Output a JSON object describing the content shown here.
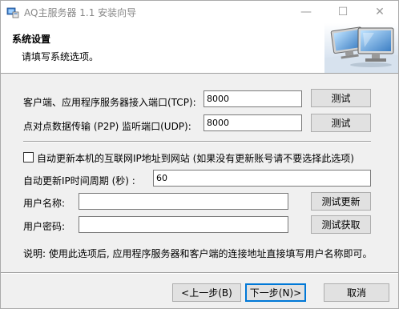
{
  "window": {
    "title": "AQ主服务器 1.1 安装向导",
    "minimize_glyph": "—",
    "maximize_glyph": "☐",
    "close_glyph": "✕"
  },
  "header": {
    "title": "系统设置",
    "subtitle": "请填写系统选项。"
  },
  "form": {
    "tcp_label": "客户端、应用程序服务器接入端口(TCP):",
    "tcp_value": "8000",
    "tcp_test": "测试",
    "udp_label": "点对点数据传输 (P2P) 监听端口(UDP):",
    "udp_value": "8000",
    "udp_test": "测试",
    "auto_update_label": "自动更新本机的互联网IP地址到网站 (如果没有更新账号请不要选择此选项)",
    "auto_update_checked": false,
    "period_label": "自动更新IP时间周期 (秒) :",
    "period_value": "60",
    "username_label": "用户名称:",
    "username_value": "",
    "test_update": "测试更新",
    "password_label": "用户密码:",
    "password_value": "",
    "test_fetch": "测试获取",
    "note": "说明: 使用此选项后, 应用程序服务器和客户端的连接地址直接填写用户名称即可。"
  },
  "footer": {
    "back": "<上一步(B)",
    "next": "下一步(N)>",
    "cancel": "取消"
  },
  "colors": {
    "accent": "#0078d7",
    "dialog_bg": "#f0f0f0",
    "header_bg": "#ffffff"
  }
}
